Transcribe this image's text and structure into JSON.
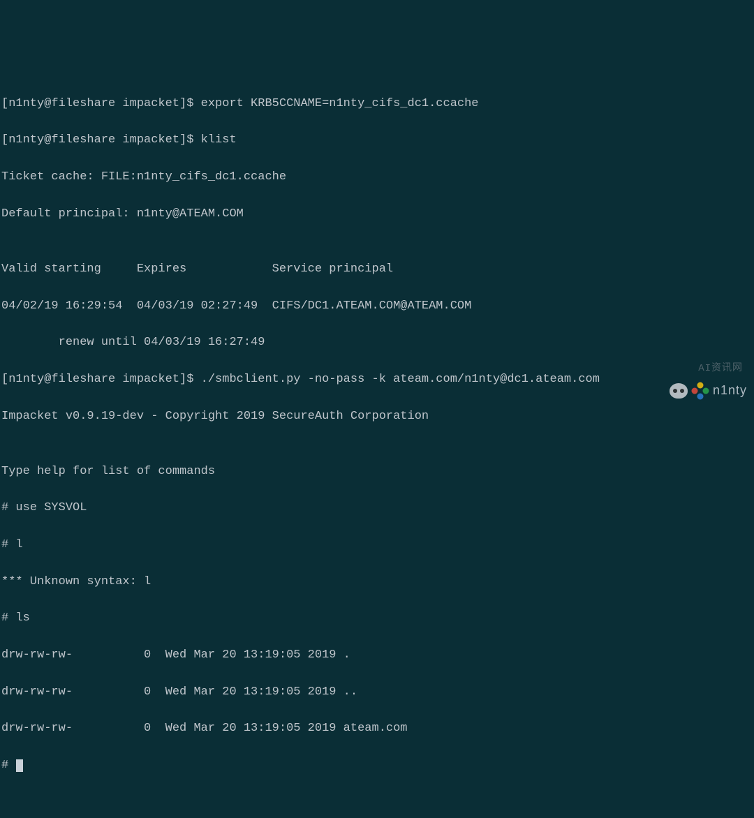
{
  "lines": [
    "[n1nty@fileshare impacket]$ export KRB5CCNAME=n1nty_cifs_dc1.ccache",
    "[n1nty@fileshare impacket]$ klist",
    "Ticket cache: FILE:n1nty_cifs_dc1.ccache",
    "Default principal: n1nty@ATEAM.COM",
    "",
    "Valid starting     Expires            Service principal",
    "04/02/19 16:29:54  04/03/19 02:27:49  CIFS/DC1.ATEAM.COM@ATEAM.COM",
    "        renew until 04/03/19 16:27:49",
    "[n1nty@fileshare impacket]$ ./smbclient.py -no-pass -k ateam.com/n1nty@dc1.ateam.com",
    "Impacket v0.9.19-dev - Copyright 2019 SecureAuth Corporation",
    "",
    "Type help for list of commands",
    "# use SYSVOL",
    "# l",
    "*** Unknown syntax: l",
    "# ls",
    "drw-rw-rw-          0  Wed Mar 20 13:19:05 2019 .",
    "drw-rw-rw-          0  Wed Mar 20 13:19:05 2019 ..",
    "drw-rw-rw-          0  Wed Mar 20 13:19:05 2019 ateam.com"
  ],
  "final_prompt": "# ",
  "watermark": {
    "text": "n1nty",
    "small": "AI资讯网"
  }
}
